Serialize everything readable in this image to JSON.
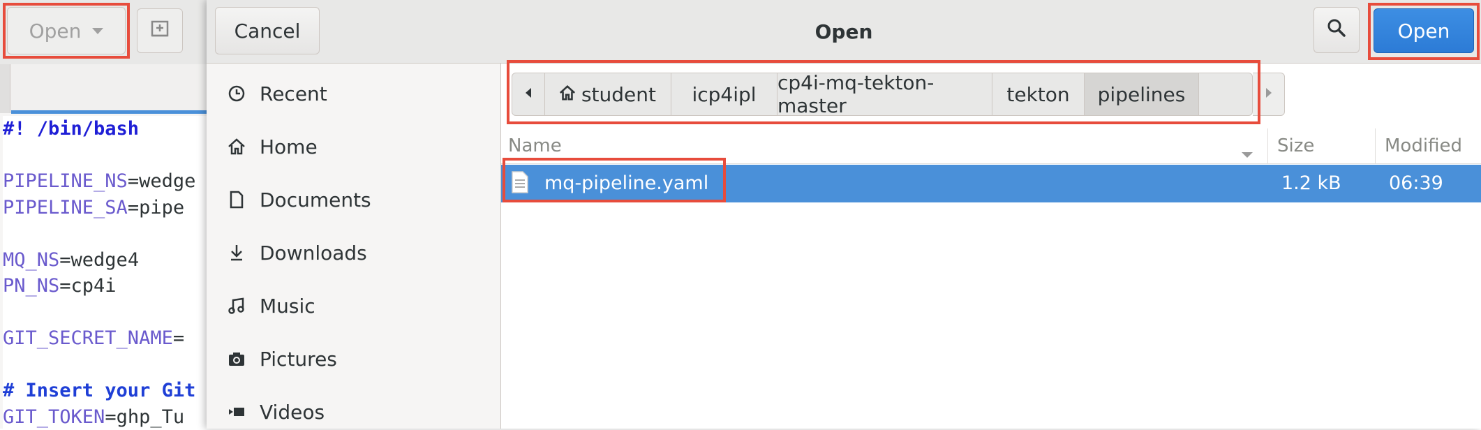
{
  "editor": {
    "open_label": "Open",
    "code_lines": [
      {
        "parts": [
          {
            "t": "#! /bin/bash",
            "c": "kw"
          }
        ]
      },
      {
        "parts": []
      },
      {
        "parts": [
          {
            "t": "PIPELINE_NS",
            "c": "var"
          },
          {
            "t": "=wedge",
            "c": ""
          }
        ]
      },
      {
        "parts": [
          {
            "t": "PIPELINE_SA",
            "c": "var"
          },
          {
            "t": "=pipe",
            "c": ""
          }
        ]
      },
      {
        "parts": []
      },
      {
        "parts": [
          {
            "t": "MQ_NS",
            "c": "var"
          },
          {
            "t": "=wedge4",
            "c": ""
          }
        ]
      },
      {
        "parts": [
          {
            "t": "PN_NS",
            "c": "var"
          },
          {
            "t": "=cp4i",
            "c": ""
          }
        ]
      },
      {
        "parts": []
      },
      {
        "parts": [
          {
            "t": "GIT_SECRET_NAME",
            "c": "var"
          },
          {
            "t": "=",
            "c": ""
          }
        ]
      },
      {
        "parts": []
      },
      {
        "parts": [
          {
            "t": "# Insert your Git",
            "c": "cmt"
          }
        ]
      },
      {
        "parts": [
          {
            "t": "GIT_TOKEN",
            "c": "var"
          },
          {
            "t": "=ghp_Tu",
            "c": ""
          }
        ]
      }
    ]
  },
  "dialog": {
    "title": "Open",
    "cancel_label": "Cancel",
    "open_label": "Open",
    "sidebar": [
      {
        "label": "Recent",
        "icon": "clock-icon"
      },
      {
        "label": "Home",
        "icon": "home-icon"
      },
      {
        "label": "Documents",
        "icon": "document-icon"
      },
      {
        "label": "Downloads",
        "icon": "download-icon"
      },
      {
        "label": "Music",
        "icon": "music-icon"
      },
      {
        "label": "Pictures",
        "icon": "camera-icon"
      },
      {
        "label": "Videos",
        "icon": "video-icon"
      }
    ],
    "breadcrumbs": [
      "student",
      "icp4ipl",
      "cp4i-mq-tekton-master",
      "tekton",
      "pipelines"
    ],
    "columns": {
      "name": "Name",
      "size": "Size",
      "modified": "Modified"
    },
    "files": [
      {
        "name": "mq-pipeline.yaml",
        "size": "1.2 kB",
        "modified": "06:39"
      }
    ]
  },
  "colors": {
    "accent": "#4a90d9",
    "highlight": "#e74c3c",
    "header": "#e8e8e7"
  }
}
